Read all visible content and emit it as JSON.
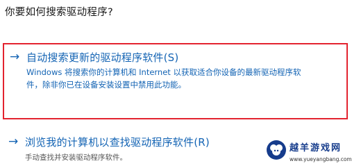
{
  "dialog": {
    "question": "你要如何搜索驱动程序?"
  },
  "options": [
    {
      "title": "自动搜索更新的驱动程序软件(S)",
      "desc_line1": "Windows 将搜索你的计算机和 Internet 以获取适合你设备的最新驱动程序软",
      "desc_line2": "件，除非你已在设备安装设置中禁用此功能。",
      "icon": "arrow-right-icon",
      "selected": true
    },
    {
      "title": "浏览我的计算机以查找驱动程序软件(R)",
      "desc_line1": "手动查找并安装驱动程序软件。",
      "icon": "arrow-right-icon",
      "selected": false
    }
  ],
  "watermark": {
    "name": "越羊游戏网",
    "url": "www.yueyangbang.com"
  },
  "colors": {
    "link_blue": "#1464b4",
    "highlight_red": "#e3232f",
    "watermark_blue": "#163c8c"
  }
}
